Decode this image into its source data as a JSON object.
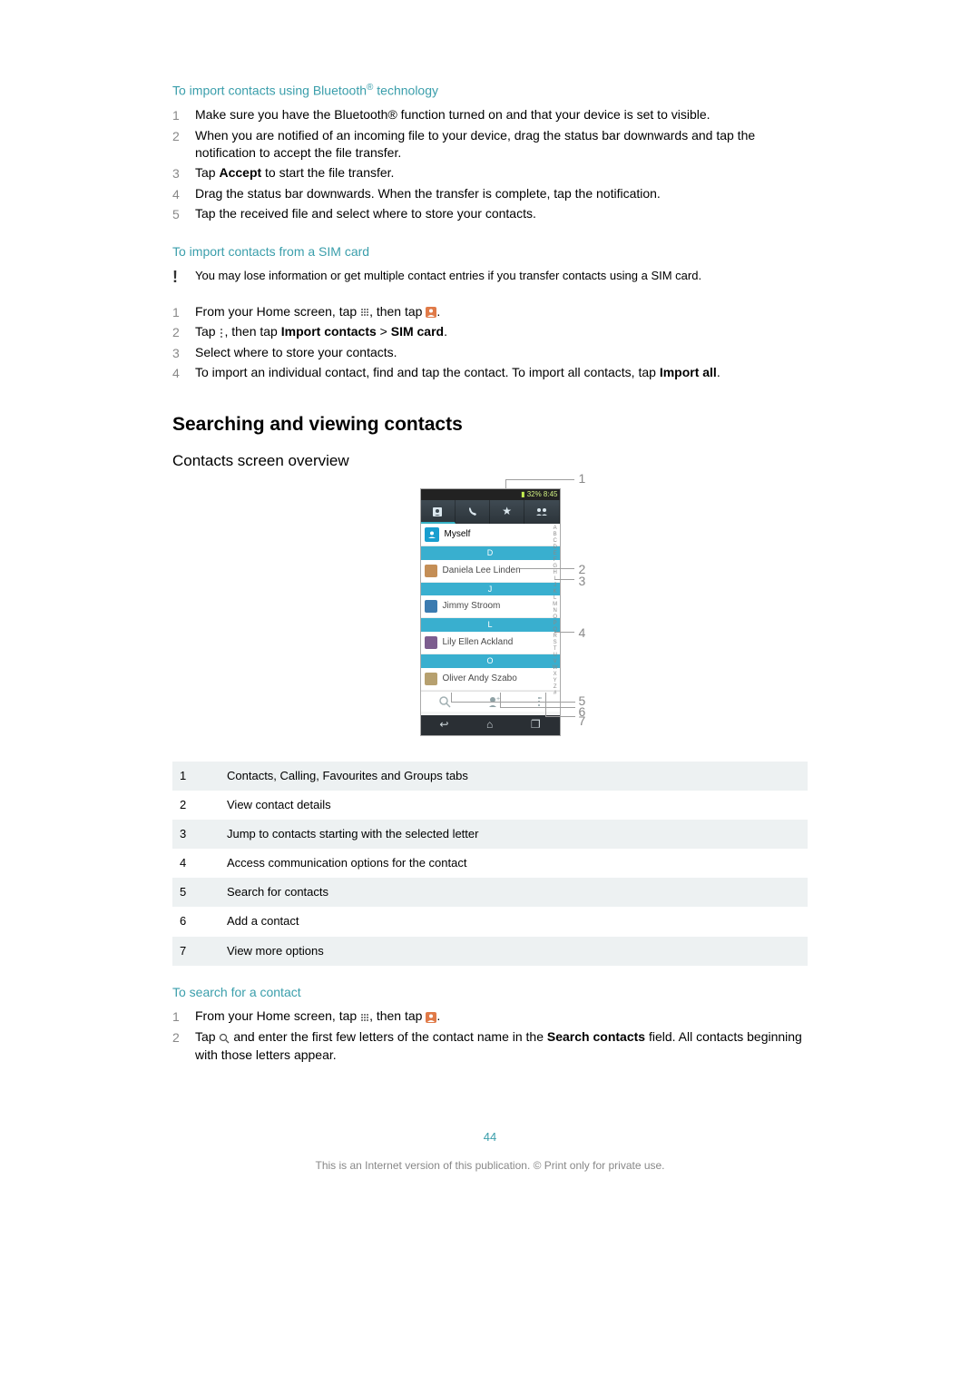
{
  "doc": {
    "h1": "To import contacts using Bluetooth",
    "h1_sup": "®",
    "h1_suffix": " technology",
    "steps1": [
      "Make sure you have the Bluetooth® function turned on and that your device is set to visible.",
      "When you are notified of an incoming file to your device, drag the status bar downwards and tap the notification to accept the file transfer.",
      "Tap Accept to start the file transfer.",
      "Drag the status bar downwards. When the transfer is complete, tap the notification.",
      "Tap the received file and select where to store your contacts."
    ],
    "step1_bold": {
      "2": "Accept"
    },
    "h2": "To import contacts from a SIM card",
    "warning": "You may lose information or get multiple contact entries if you transfer contacts using a SIM card.",
    "steps2": {
      "1": {
        "pre": "From your Home screen, tap ",
        "mid": ", then tap ",
        "post": "."
      },
      "2": {
        "pre": "Tap ",
        "mid": ", then tap ",
        "b1": "Import contacts",
        "gt": " > ",
        "b2": "SIM card",
        "post": "."
      },
      "3": "Select where to store your contacts.",
      "4": {
        "pre": "To import an individual contact, find and tap the contact. To import all contacts, tap ",
        "b1": "Import all",
        "post": "."
      }
    },
    "h3": "Searching and viewing contacts",
    "h4": "Contacts screen overview",
    "legend": [
      "Contacts, Calling, Favourites and Groups tabs",
      "View contact details",
      "Jump to contacts starting with the selected letter",
      "Access communication options for the contact",
      "Search for contacts",
      "Add a contact",
      "View more options"
    ],
    "h5": "To search for a contact",
    "steps3": {
      "1": {
        "pre": "From your Home screen, tap ",
        "mid": ", then tap ",
        "post": "."
      },
      "2": {
        "pre": "Tap ",
        "mid": " and enter the first few letters of the contact name in the ",
        "b1": "Search contacts",
        "post": " field. All contacts beginning with those letters appear."
      }
    },
    "pagenum": "44",
    "footer": "This is an Internet version of this publication. © Print only for private use."
  },
  "shot": {
    "status": "32% 8:45",
    "myself": "Myself",
    "sections": [
      "D",
      "J",
      "L",
      "O"
    ],
    "contacts": [
      "Daniela Lee Linden",
      "Jimmy Stroom",
      "Lily Ellen Ackland",
      "Oliver Andy Szabo"
    ],
    "az": "A\nB\nC\nD\nE\nF\nG\nH\nI\nJ\nK\nL\nM\nN\nO\nP\nQ\nR\nS\nT\nU\nV\nW\nX\nY\nZ\n#",
    "callouts": [
      "1",
      "2",
      "3",
      "4",
      "5",
      "6",
      "7"
    ]
  }
}
